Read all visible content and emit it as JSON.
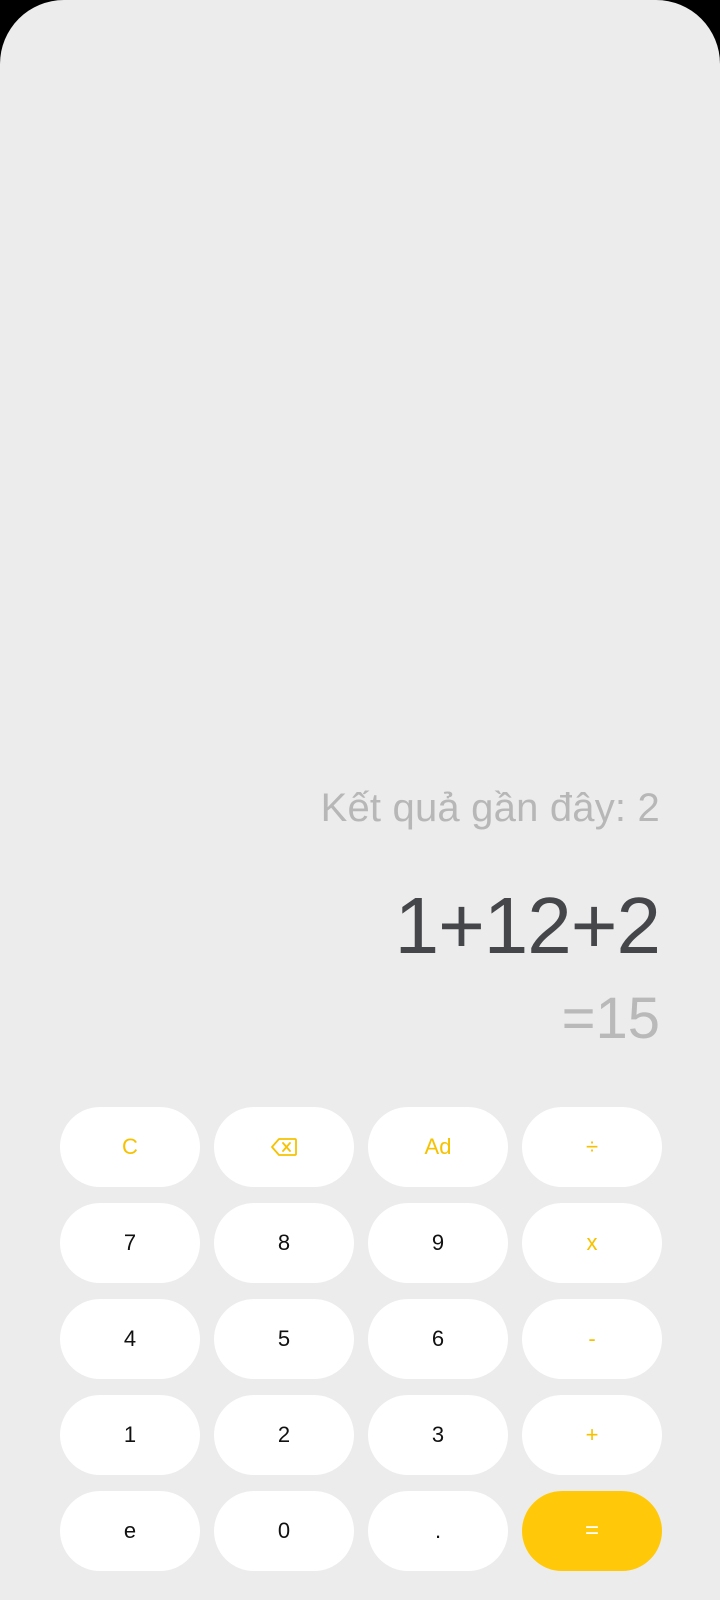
{
  "display": {
    "recent_label": "Kết quả gần đây: 2",
    "expression": "1+12+2",
    "result": "=15"
  },
  "colors": {
    "background": "#ECECEC",
    "key_background": "#FFFFFF",
    "accent": "#F6C200",
    "equals_background": "#FFC90A",
    "expression_text": "#45464A",
    "muted_text": "#B7B7B7"
  },
  "keypad": {
    "clear": "C",
    "backspace_icon": "backspace-icon",
    "ad": "Ad",
    "divide": "÷",
    "seven": "7",
    "eight": "8",
    "nine": "9",
    "multiply": "x",
    "four": "4",
    "five": "5",
    "six": "6",
    "minus": "-",
    "one": "1",
    "two": "2",
    "three": "3",
    "plus": "+",
    "e": "e",
    "zero": "0",
    "dot": ".",
    "equals": "="
  }
}
